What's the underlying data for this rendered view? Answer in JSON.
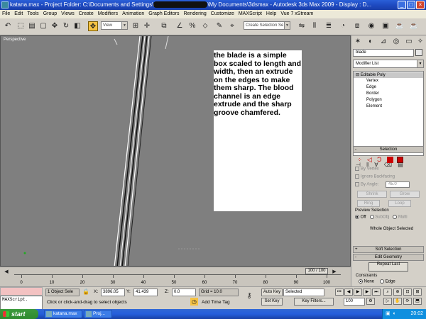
{
  "window": {
    "title_left": "katana.max   - Project Folder: C:\\Documents and Settings\\",
    "title_right": "\\My Documents\\3dsmax    - Autodesk 3ds Max  2009       - Display : D...",
    "min": "_",
    "max": "□",
    "close": "×"
  },
  "menu": [
    "File",
    "Edit",
    "Tools",
    "Group",
    "Views",
    "Create",
    "Modifiers",
    "Animation",
    "Graph Editors",
    "Rendering",
    "Customize",
    "MAXScript",
    "Help",
    "Vue 7 xStream"
  ],
  "toolbar": {
    "view_combo": "View",
    "selection_set": "Create Selection Se"
  },
  "viewport": {
    "label": "Perspective",
    "annotation": "the blade is a simple box scaled to length and width, then an extrude on the edges to make them sharp. The blood channel is an edge extrude and the sharp groove chamfered."
  },
  "command_panel": {
    "object_name": "blade",
    "modifier_list": "Modifier List",
    "stack_root": "Editable Poly",
    "stack_items": [
      "Vertex",
      "Edge",
      "Border",
      "Polygon",
      "Element"
    ],
    "selection": {
      "title": "Selection",
      "by_vertex": "By Vertex",
      "ignore_backfacing": "Ignore Backfacing",
      "by_angle": "By Angle:",
      "angle_value": "45.0",
      "shrink": "Shrink",
      "grow": "Grow",
      "ring": "Ring",
      "loop": "Loop",
      "preview_title": "Preview Selection",
      "preview_off": "Off",
      "preview_subobj": "SubObj",
      "preview_multi": "Multi",
      "status": "Whole Object Selected"
    },
    "soft_selection": "Soft Selection",
    "edit_geometry": "Edit Geometry",
    "repeat_last": "Repeat Last",
    "constraints_title": "Constraints",
    "constraint_none": "None",
    "constraint_edge": "Edge"
  },
  "timeline": {
    "frame": "100 / 100",
    "ticks": [
      "0",
      "10",
      "20",
      "30",
      "40",
      "50",
      "60",
      "70",
      "80",
      "90",
      "100"
    ]
  },
  "status": {
    "selected_count": "1 Object Sele",
    "x_label": "X:",
    "x_value": "3896.05",
    "y_label": "Y:",
    "y_value": "41.439",
    "z_label": "Z:",
    "z_value": "0.0",
    "grid": "Grid = 10.0",
    "prompt": "Click or click-and-drag to select objects",
    "add_time_tag": "Add Time Tag",
    "auto_key": "Auto Key",
    "set_key": "Set Key",
    "key_filter": "Selected",
    "key_filters_btn": "Key Filters...",
    "frame_field": "100",
    "maxscript": "MAXScript."
  },
  "taskbar": {
    "start": "start",
    "tasks": [
      "katana.max",
      "Proj..."
    ],
    "clock": "20:02"
  }
}
